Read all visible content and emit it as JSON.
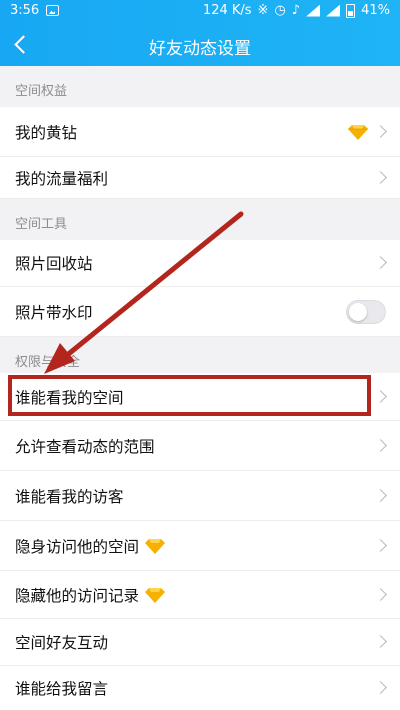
{
  "status_bar": {
    "time": "3:56",
    "network_speed": "124 K/s",
    "battery": "41%"
  },
  "nav": {
    "title": "好友动态设置"
  },
  "sections": {
    "space_rights": {
      "header": "空间权益",
      "items": [
        "我的黄钻",
        "我的流量福利"
      ]
    },
    "space_tools": {
      "header": "空间工具",
      "items": [
        "照片回收站",
        "照片带水印"
      ]
    },
    "privacy": {
      "header": "权限与安全",
      "items": [
        "谁能看我的空间",
        "允许查看动态的范围",
        "谁能看我的访客",
        "隐身访问他的空间",
        "隐藏他的访问记录",
        "空间好友互动",
        "谁能给我留言"
      ]
    }
  },
  "colors": {
    "accent": "#1aaaf3",
    "annotation": "#b3261e",
    "diamond": "#f5b100"
  },
  "icons": {
    "back": "back-arrow-icon",
    "chevron": "chevron-right-icon",
    "diamond": "yellow-diamond-icon"
  },
  "toggle_watermark": false
}
